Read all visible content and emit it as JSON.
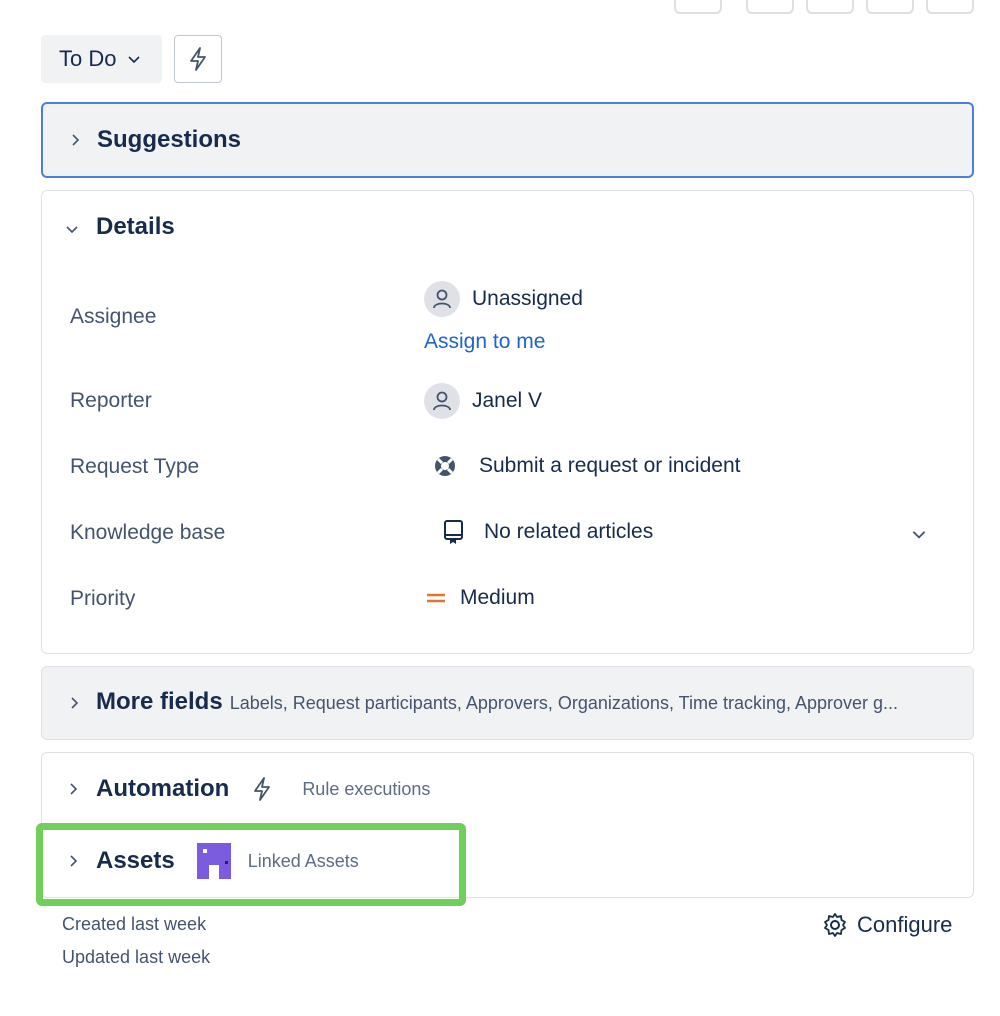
{
  "status": {
    "label": "To Do"
  },
  "suggestions": {
    "title": "Suggestions"
  },
  "details": {
    "title": "Details",
    "assignee": {
      "label": "Assignee",
      "value": "Unassigned",
      "assign_link": "Assign to me"
    },
    "reporter": {
      "label": "Reporter",
      "value": "Janel V"
    },
    "request_type": {
      "label": "Request Type",
      "value": "Submit a request or incident"
    },
    "knowledge_base": {
      "label": "Knowledge base",
      "value": "No related articles"
    },
    "priority": {
      "label": "Priority",
      "value": "Medium",
      "color": "#e0772f"
    }
  },
  "more_fields": {
    "title": "More fields",
    "summary": "Labels, Request participants, Approvers, Organizations, Time tracking, Approver g..."
  },
  "automation": {
    "title": "Automation",
    "sub": "Rule executions"
  },
  "assets": {
    "title": "Assets",
    "sub": "Linked Assets",
    "icon_color": "#7b5ce0"
  },
  "footer": {
    "created": "Created last week",
    "updated": "Updated last week",
    "configure": "Configure"
  },
  "colors": {
    "link": "#1d63d1",
    "focus_border": "#4c7fd9",
    "highlight": "#6fcf5a"
  }
}
